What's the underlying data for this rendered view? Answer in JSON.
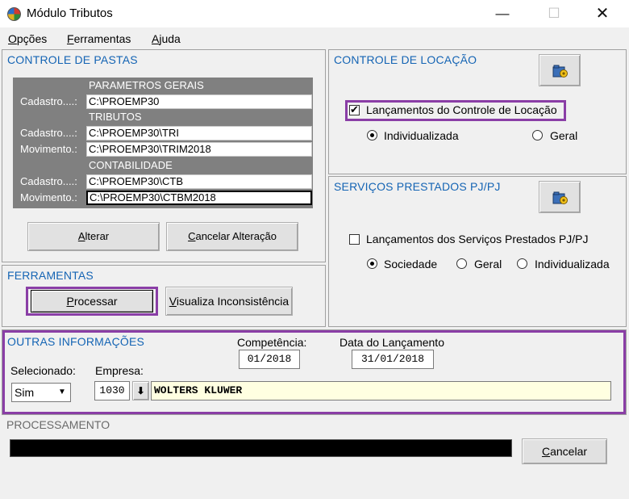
{
  "window": {
    "title": "Módulo Tributos",
    "minimize": "—",
    "maximize": "☐",
    "close": "✕"
  },
  "menu": [
    {
      "first": "O",
      "rest": "pções"
    },
    {
      "first": "F",
      "rest": "erramentas"
    },
    {
      "first": "A",
      "rest": "juda"
    }
  ],
  "pastas": {
    "title": "CONTROLE DE PASTAS",
    "parametros_header": "PARAMETROS GERAIS",
    "parametros_cadastro_label": "Cadastro....:",
    "parametros_cadastro_value": "C:\\PROEMP30",
    "tributos_header": "TRIBUTOS",
    "tributos_cadastro_label": "Cadastro....:",
    "tributos_cadastro_value": "C:\\PROEMP30\\TRI",
    "tributos_movimento_label": "Movimento.:",
    "tributos_movimento_value": "C:\\PROEMP30\\TRIM2018",
    "contabilidade_header": "CONTABILIDADE",
    "contabilidade_cadastro_label": "Cadastro....:",
    "contabilidade_cadastro_value": "C:\\PROEMP30\\CTB",
    "contabilidade_movimento_label": "Movimento.:",
    "contabilidade_movimento_value": "C:\\PROEMP30\\CTBM2018",
    "alterar_first": "A",
    "alterar_rest": "lterar",
    "cancelar_first": "C",
    "cancelar_rest": "ancelar Alteração"
  },
  "locacao": {
    "title": "CONTROLE DE LOCAÇÃO",
    "checkbox_label": "Lançamentos do Controle de Locação",
    "checked": true,
    "radio_individualizada": "Individualizada",
    "radio_geral": "Geral",
    "selected": "Individualizada"
  },
  "servicos": {
    "title": "SERVIÇOS PRESTADOS PJ/PJ",
    "checkbox_label": "Lançamentos dos Serviços Prestados PJ/PJ",
    "checked": false,
    "radio_sociedade": "Sociedade",
    "radio_geral": "Geral",
    "radio_individualizada": "Individualizada",
    "selected": "Sociedade"
  },
  "ferramentas": {
    "title": "FERRAMENTAS",
    "processar_first": "P",
    "processar_rest": "rocessar",
    "visualiza_first": "V",
    "visualiza_rest": "isualiza Inconsistência"
  },
  "outras": {
    "title": "OUTRAS INFORMAÇÕES",
    "competencia_label": "Competência:",
    "competencia_value": "01/2018",
    "data_label": "Data do Lançamento",
    "data_value": "31/01/2018",
    "selecionado_label": "Selecionado:",
    "selecionado_value": "Sim",
    "empresa_label": "Empresa:",
    "empresa_code": "1030",
    "empresa_name": "WOLTERS KLUWER"
  },
  "processamento": {
    "title": "PROCESSAMENTO",
    "cancelar_first": "C",
    "cancelar_rest": "ancelar"
  },
  "colors": {
    "title_blue": "#1464b4",
    "highlight": "#8a3ea6",
    "header_grey": "#808080",
    "empresa_bg": "#ffffe1"
  }
}
